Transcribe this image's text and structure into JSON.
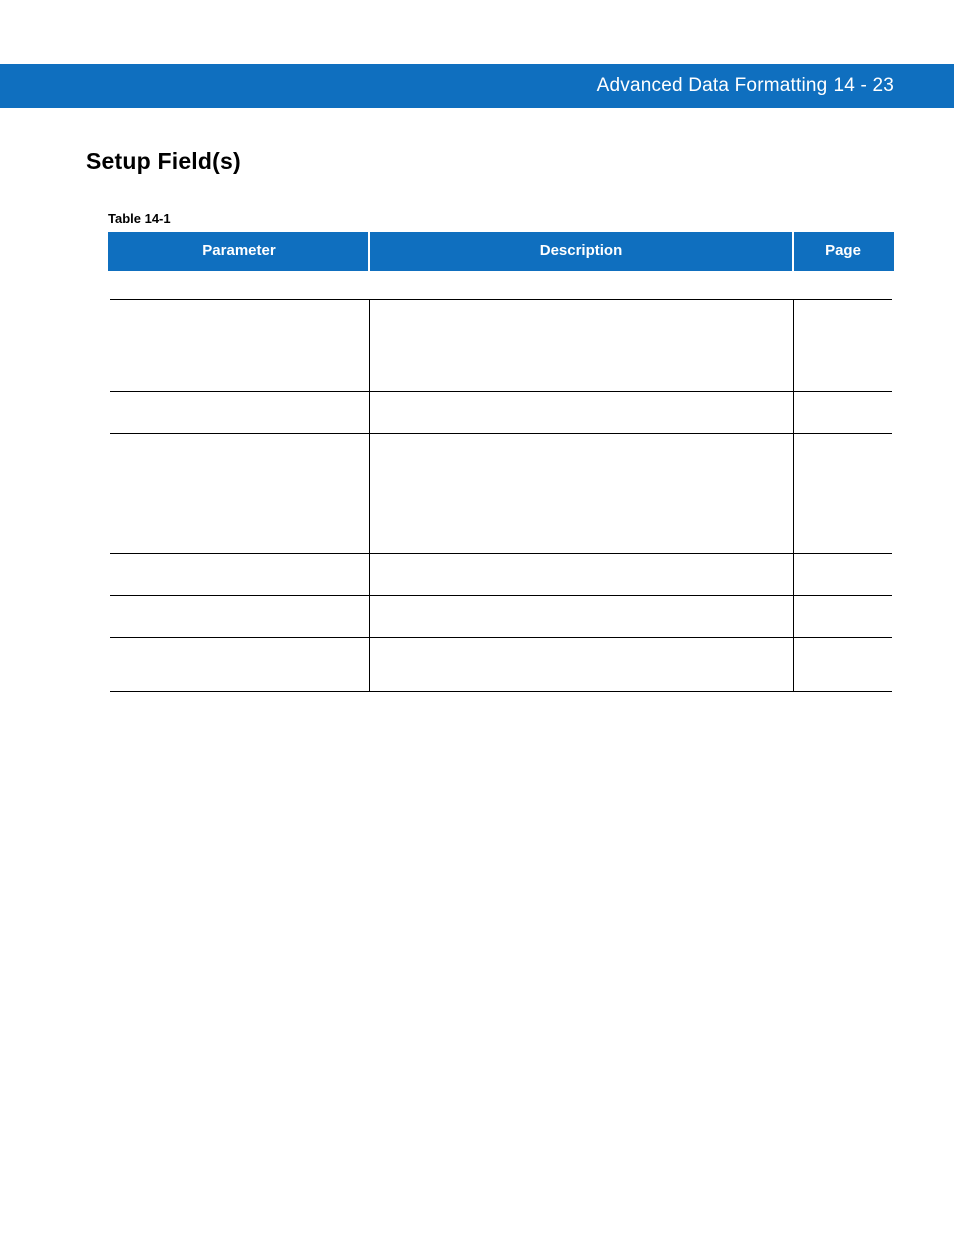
{
  "header": {
    "title": "Advanced Data Formatting",
    "page_label": "14 - 23"
  },
  "section": {
    "heading": "Setup Field(s)"
  },
  "table": {
    "caption": "Table 14-1",
    "columns": {
      "parameter": "Parameter",
      "description": "Description",
      "page": "Page"
    },
    "rows": [
      {
        "parameter": "",
        "description": "",
        "page": ""
      },
      {
        "parameter": "",
        "description": "",
        "page": ""
      },
      {
        "parameter": "",
        "description": "",
        "page": ""
      },
      {
        "parameter": "",
        "description": "",
        "page": ""
      },
      {
        "parameter": "",
        "description": "",
        "page": ""
      },
      {
        "parameter": "",
        "description": "",
        "page": ""
      }
    ]
  }
}
